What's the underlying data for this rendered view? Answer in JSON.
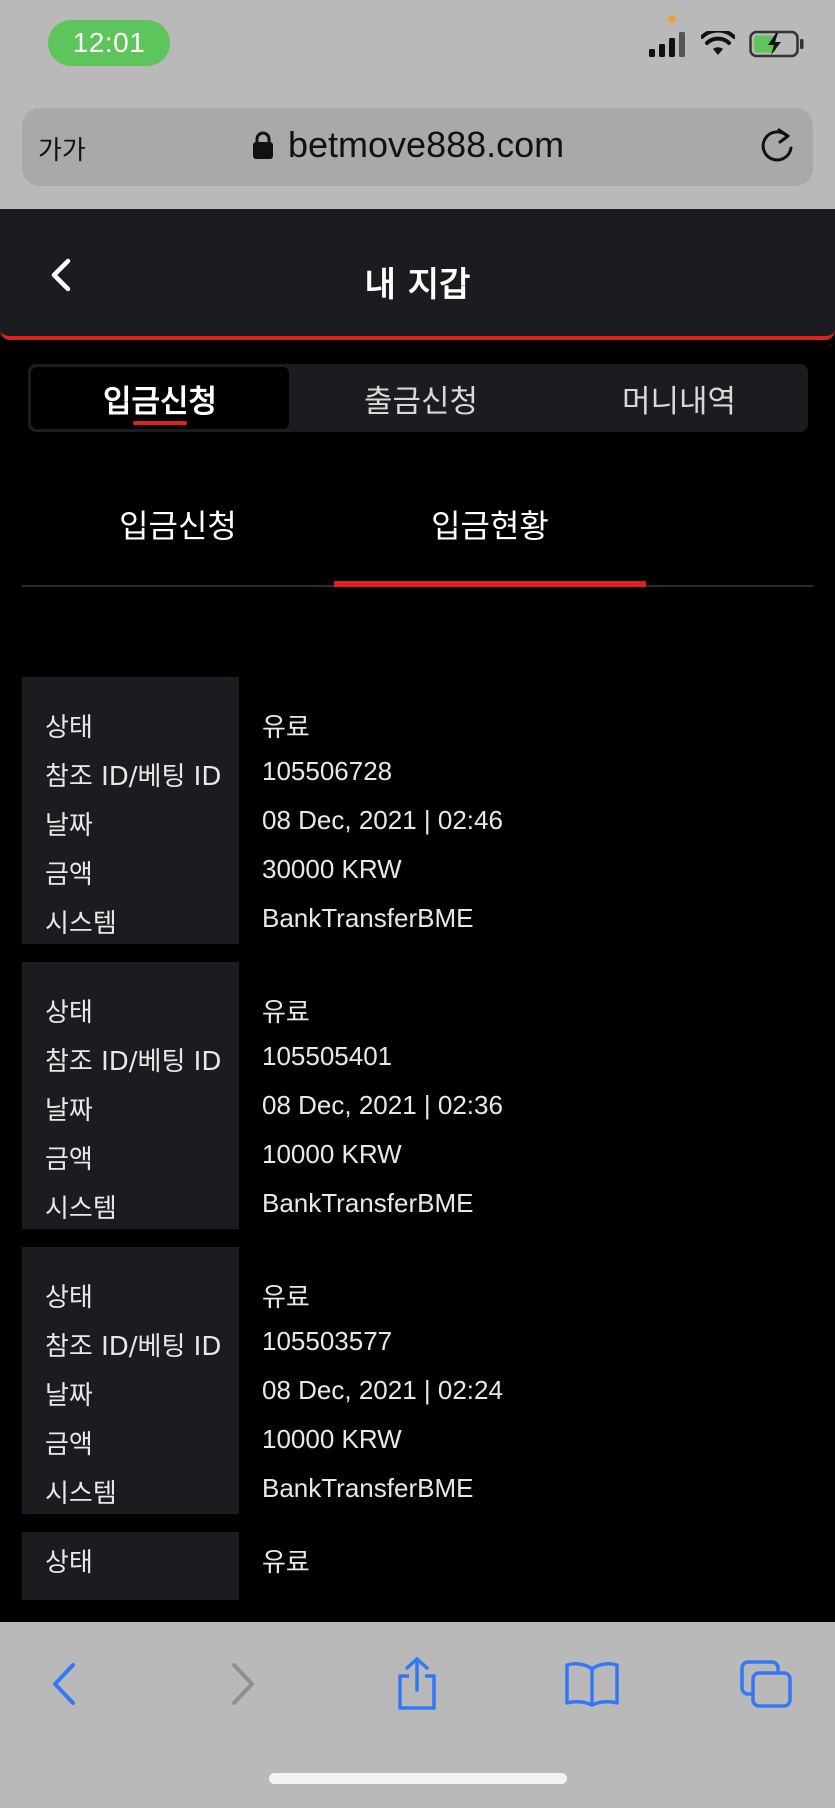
{
  "status_bar": {
    "time": "12:01"
  },
  "browser": {
    "text_size_label": "가가",
    "url": "betmove888.com"
  },
  "header": {
    "title": "내 지갑"
  },
  "main_tabs": [
    {
      "label": "입금신청",
      "active": true
    },
    {
      "label": "출금신청",
      "active": false
    },
    {
      "label": "머니내역",
      "active": false
    }
  ],
  "sub_tabs": [
    {
      "label": "입금신청",
      "active": false
    },
    {
      "label": "입금현황",
      "active": true
    }
  ],
  "field_labels": {
    "status": "상태",
    "ref_id": "참조 ID/베팅 ID",
    "date": "날짜",
    "amount": "금액",
    "system": "시스템"
  },
  "records": [
    {
      "status": "유료",
      "ref_id": "105506728",
      "date": "08 Dec, 2021 | 02:46",
      "amount": "30000 KRW",
      "system": "BankTransferBME"
    },
    {
      "status": "유료",
      "ref_id": "105505401",
      "date": "08 Dec, 2021 | 02:36",
      "amount": "10000 KRW",
      "system": "BankTransferBME"
    },
    {
      "status": "유료",
      "ref_id": "105503577",
      "date": "08 Dec, 2021 | 02:24",
      "amount": "10000 KRW",
      "system": "BankTransferBME"
    },
    {
      "status": "유료"
    }
  ],
  "colors": {
    "accent": "#e0201f",
    "panel": "#1b1c20",
    "browser_chrome": "#b9b9b9",
    "ios_blue": "#3478f6"
  },
  "icons": {
    "back": "chevron-left-icon",
    "lock": "lock-icon",
    "reload": "reload-icon",
    "nav_back": "arrow-back-icon",
    "nav_forward": "arrow-forward-icon",
    "share": "share-icon",
    "bookmarks": "book-icon",
    "tabs": "tabs-icon"
  }
}
